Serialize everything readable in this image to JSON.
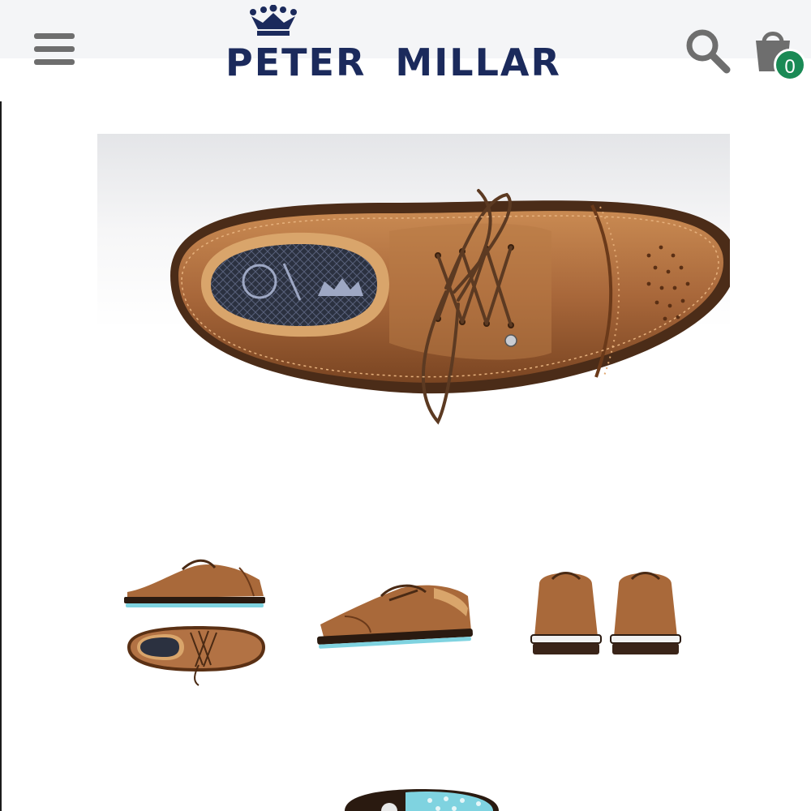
{
  "header": {
    "brand": "PETER  MILLAR",
    "cart_count": "0"
  },
  "icons": {
    "menu": "hamburger-menu-icon",
    "logo_crown": "crown-icon",
    "search": "search-icon",
    "cart": "shopping-bag-icon"
  },
  "product": {
    "main_image": "golf-shoe-top-view",
    "thumbnails": [
      {
        "name": "side-and-top-view"
      },
      {
        "name": "three-quarter-view"
      },
      {
        "name": "rear-view-pair"
      },
      {
        "name": "sole-view"
      }
    ]
  },
  "colors": {
    "brand_navy": "#1b2a5c",
    "badge_green": "#1a8a55",
    "leather": "#a86a38",
    "sole_blue": "#7fd3e0",
    "icon_grey": "#6e6e6e"
  }
}
